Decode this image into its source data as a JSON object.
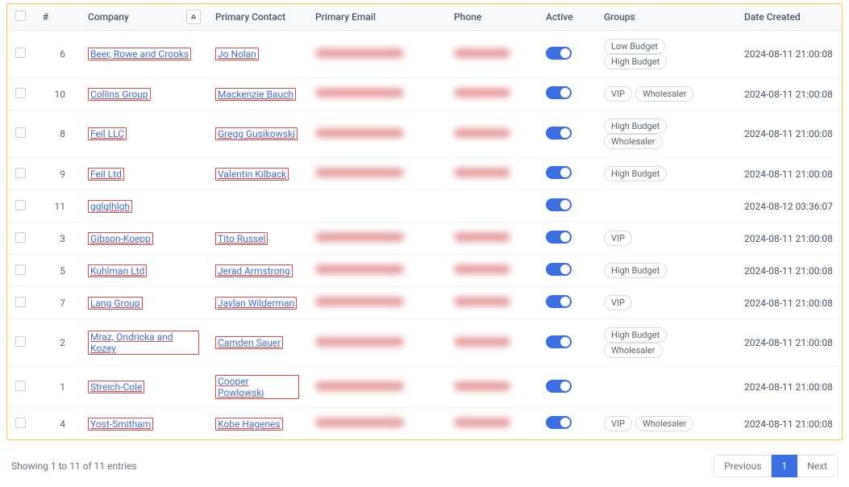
{
  "columns": {
    "checkbox": "",
    "num": "#",
    "company": "Company",
    "contact": "Primary Contact",
    "email": "Primary Email",
    "phone": "Phone",
    "active": "Active",
    "groups": "Groups",
    "date": "Date Created"
  },
  "sort": {
    "column": "company",
    "direction": "asc"
  },
  "rows": [
    {
      "num": "6",
      "company": "Beer, Rowe and Crooks",
      "contact": "Jo Nolan",
      "email_hidden": true,
      "phone_hidden": true,
      "active": true,
      "groups": [
        "Low Budget",
        "High Budget"
      ],
      "date": "2024-08-11 21:00:08"
    },
    {
      "num": "10",
      "company": "Collins Group",
      "contact": "Mackenzie Bauch",
      "email_hidden": true,
      "phone_hidden": true,
      "active": true,
      "groups": [
        "VIP",
        "Wholesaler"
      ],
      "date": "2024-08-11 21:00:08"
    },
    {
      "num": "8",
      "company": "Feil LLC",
      "contact": "Gregg Gusikowski",
      "email_hidden": true,
      "phone_hidden": true,
      "active": true,
      "groups": [
        "High Budget",
        "Wholesaler"
      ],
      "date": "2024-08-11 21:00:08"
    },
    {
      "num": "9",
      "company": "Feil Ltd",
      "contact": "Valentin Kilback",
      "email_hidden": true,
      "phone_hidden": true,
      "active": true,
      "groups": [
        "High Budget"
      ],
      "date": "2024-08-11 21:00:08"
    },
    {
      "num": "11",
      "company": "gglglhlgh",
      "contact": "",
      "email_hidden": false,
      "phone_hidden": false,
      "active": true,
      "groups": [],
      "date": "2024-08-12 03:36:07"
    },
    {
      "num": "3",
      "company": "Gibson-Koepp",
      "contact": "Tito Russel",
      "email_hidden": true,
      "phone_hidden": true,
      "active": true,
      "groups": [
        "VIP"
      ],
      "date": "2024-08-11 21:00:08"
    },
    {
      "num": "5",
      "company": "Kuhlman Ltd",
      "contact": "Jerad Armstrong",
      "email_hidden": true,
      "phone_hidden": true,
      "active": true,
      "groups": [
        "High Budget"
      ],
      "date": "2024-08-11 21:00:08"
    },
    {
      "num": "7",
      "company": "Lang Group",
      "contact": "Jaylan Wilderman",
      "email_hidden": true,
      "phone_hidden": true,
      "active": true,
      "groups": [
        "VIP"
      ],
      "date": "2024-08-11 21:00:08"
    },
    {
      "num": "2",
      "company": "Mraz, Ondricka and Kozey",
      "contact": "Camden Sauer",
      "email_hidden": true,
      "phone_hidden": true,
      "active": true,
      "groups": [
        "High Budget",
        "Wholesaler"
      ],
      "date": "2024-08-11 21:00:08"
    },
    {
      "num": "1",
      "company": "Streich-Cole",
      "contact": "Cooper Powlowski",
      "email_hidden": true,
      "phone_hidden": true,
      "active": true,
      "groups": [],
      "date": "2024-08-11 21:00:08"
    },
    {
      "num": "4",
      "company": "Yost-Smitham",
      "contact": "Kobe Hagenes",
      "email_hidden": true,
      "phone_hidden": true,
      "active": true,
      "groups": [
        "VIP",
        "Wholesaler"
      ],
      "date": "2024-08-11 21:00:08"
    }
  ],
  "footer": {
    "summary": "Showing 1 to 11 of 11 entries",
    "prev": "Previous",
    "page": "1",
    "next": "Next"
  }
}
